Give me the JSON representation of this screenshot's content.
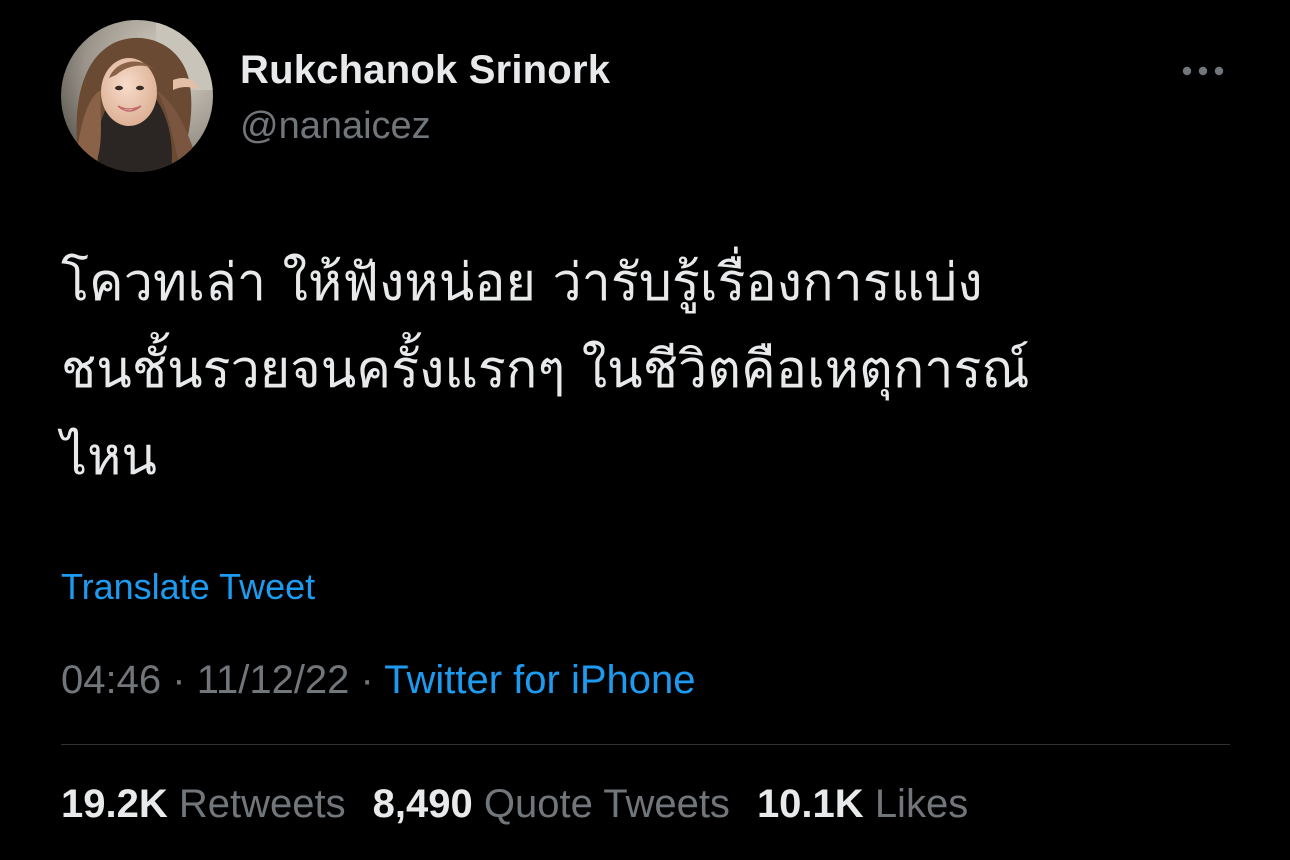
{
  "author": {
    "display_name": "Rukchanok Srinork",
    "handle": "@nanaicez",
    "avatar_icon": "profile-photo"
  },
  "menu": {
    "icon": "more-horizontal-icon"
  },
  "tweet": {
    "text": "โควทเล่า ให้ฟังหน่อย ว่ารับรู้เรื่องการแบ่ง\nชนชั้นรวยจนครั้งแรกๆ ในชีวิตคือเหตุการณ์\nไหน",
    "translate_label": "Translate Tweet",
    "time": "04:46",
    "separator": "·",
    "date": "11/12/22",
    "source": "Twitter for iPhone"
  },
  "stats": {
    "retweets_count": "19.2K",
    "retweets_label": "Retweets",
    "quotes_count": "8,490",
    "quotes_label": "Quote Tweets",
    "likes_count": "10.1K",
    "likes_label": "Likes"
  },
  "colors": {
    "background": "#000000",
    "primary_text": "#e7e9ea",
    "secondary_text": "#71767b",
    "accent": "#1d9bf0",
    "divider": "#2f3336"
  }
}
